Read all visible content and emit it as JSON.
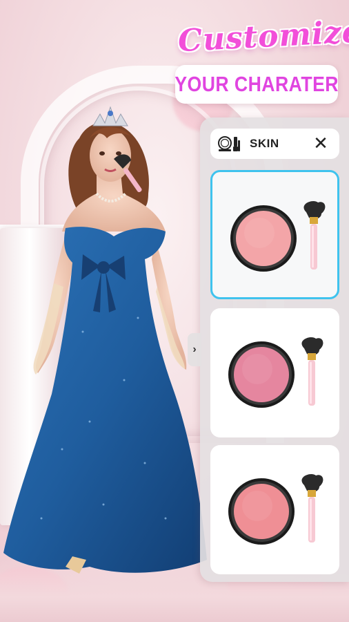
{
  "header": {
    "title_script": "Customize",
    "title_sub": "YOUR CHARATER"
  },
  "panel": {
    "category_icon": "mirror-makeup-icon",
    "category_label": "SKIN",
    "close_glyph": "✕",
    "collapse_glyph": "›",
    "items": [
      {
        "name": "blush-item-1",
        "selected": true,
        "blush_color": "#f3a5a8",
        "rim_color": "#cf8a90"
      },
      {
        "name": "blush-item-2",
        "selected": false,
        "blush_color": "#e5869f",
        "rim_color": "#c56f86"
      },
      {
        "name": "blush-item-3",
        "selected": false,
        "blush_color": "#ef8f95",
        "rim_color": "#cf7680"
      }
    ]
  },
  "colors": {
    "title_pink": "#f24fd9",
    "title_sub": "#e045e0",
    "selected_border": "#3fc3ee",
    "dress_blue": "#1f5d9e",
    "panel_bg": "#e4e0e2"
  }
}
